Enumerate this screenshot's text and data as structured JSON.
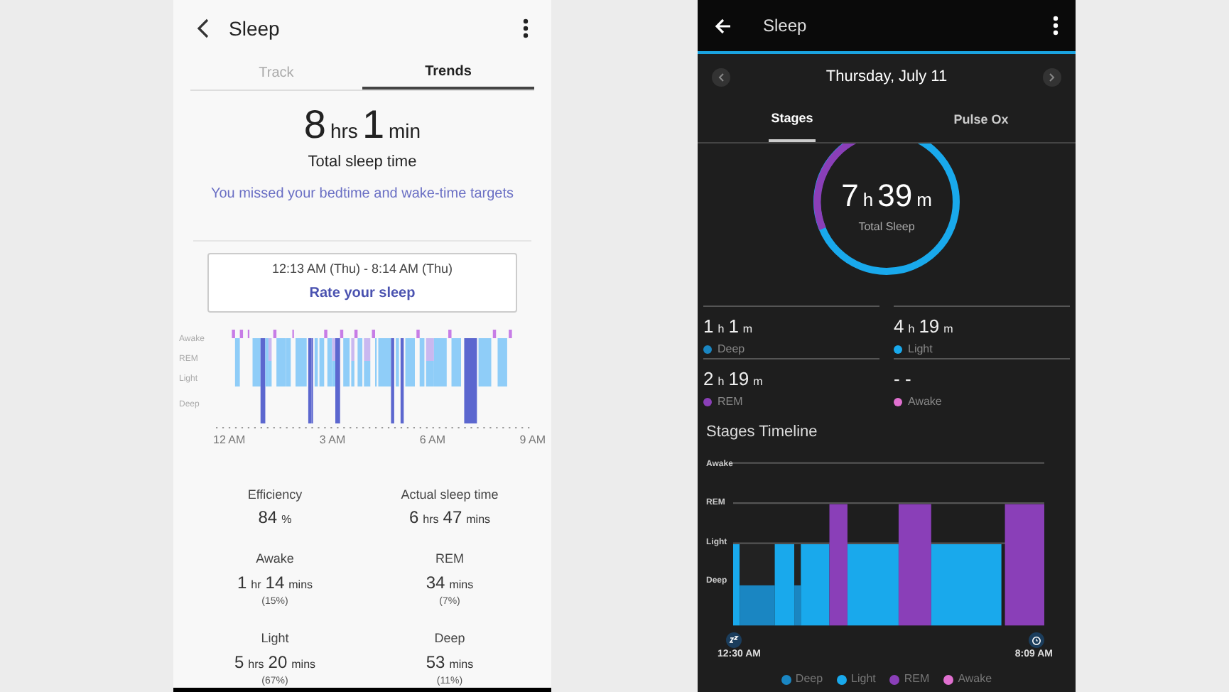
{
  "left": {
    "title": "Sleep",
    "tabs": [
      {
        "label": "Track",
        "selected": false
      },
      {
        "label": "Trends",
        "selected": true
      }
    ],
    "total": [
      {
        "n": "8",
        "u": "hrs"
      },
      {
        "n": "1",
        "u": "min"
      }
    ],
    "total_label": "Total sleep time",
    "target_message": "You missed your bedtime and wake-time targets",
    "popup": {
      "time_range": "12:13 AM (Thu) - 8:14 AM (Thu)",
      "action": "Rate your sleep"
    },
    "hypnogram": {
      "stage_labels": [
        "Awake",
        "REM",
        "Light",
        "Deep"
      ],
      "time_labels": [
        "12 AM",
        "3 AM",
        "6 AM",
        "9 AM"
      ]
    },
    "stats": [
      {
        "label": "Efficiency",
        "value": [
          {
            "n": "84",
            "u": "%"
          }
        ]
      },
      {
        "label": "Actual sleep time",
        "value": [
          {
            "n": "6",
            "u": "hrs"
          },
          {
            "n": "47",
            "u": "mins"
          }
        ]
      },
      {
        "label": "Awake",
        "value": [
          {
            "n": "1",
            "u": "hr"
          },
          {
            "n": "14",
            "u": "mins"
          }
        ],
        "percent": "(15%)"
      },
      {
        "label": "REM",
        "value": [
          {
            "n": "34",
            "u": "mins"
          }
        ],
        "percent": "(7%)"
      },
      {
        "label": "Light",
        "value": [
          {
            "n": "5",
            "u": "hrs"
          },
          {
            "n": "20",
            "u": "mins"
          }
        ],
        "percent": "(67%)"
      },
      {
        "label": "Deep",
        "value": [
          {
            "n": "53",
            "u": "mins"
          }
        ],
        "percent": "(11%)"
      }
    ]
  },
  "right": {
    "title": "Sleep",
    "date": "Thursday, July 11",
    "tabs": [
      {
        "label": "Stages",
        "selected": true
      },
      {
        "label": "Pulse Ox",
        "selected": false
      }
    ],
    "ring": {
      "value": [
        {
          "n": "7",
          "u": "h"
        },
        {
          "n": "39",
          "u": "m"
        }
      ],
      "label": "Total Sleep"
    },
    "stages": [
      {
        "value": [
          {
            "n": "1",
            "u": "h"
          },
          {
            "n": "1",
            "u": "m"
          }
        ],
        "label": "Deep",
        "color": "#1a86c2"
      },
      {
        "value": [
          {
            "n": "4",
            "u": "h"
          },
          {
            "n": "19",
            "u": "m"
          }
        ],
        "label": "Light",
        "color": "#19a9ec"
      },
      {
        "value": [
          {
            "n": "2",
            "u": "h"
          },
          {
            "n": "19",
            "u": "m"
          }
        ],
        "label": "REM",
        "color": "#8a3fb8"
      },
      {
        "value": [
          {
            "n": "- -"
          }
        ],
        "label": "Awake",
        "color": "#e070d0"
      }
    ],
    "timeline": {
      "title": "Stages Timeline",
      "stage_labels": [
        "Awake",
        "REM",
        "Light",
        "Deep"
      ],
      "start_time": "12:30 AM",
      "end_time": "8:09 AM"
    },
    "legend": [
      {
        "label": "Deep",
        "color": "#1a86c2"
      },
      {
        "label": "Light",
        "color": "#19a9ec"
      },
      {
        "label": "REM",
        "color": "#8a3fb8"
      },
      {
        "label": "Awake",
        "color": "#e070d0"
      }
    ]
  }
}
